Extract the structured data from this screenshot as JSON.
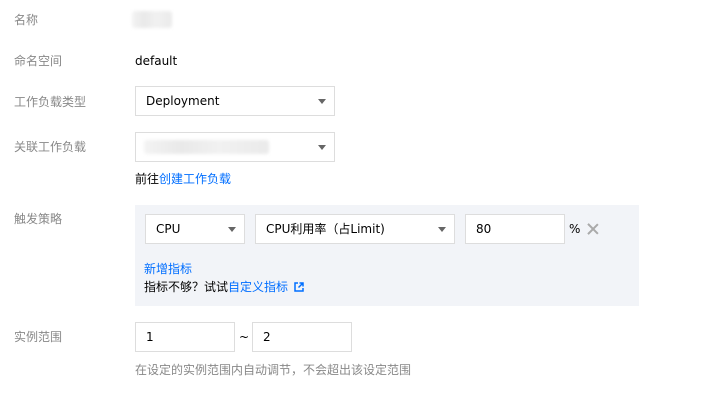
{
  "form": {
    "name": {
      "label": "名称"
    },
    "namespace": {
      "label": "命名空间",
      "value": "default"
    },
    "workload_type": {
      "label": "工作负载类型",
      "value": "Deployment"
    },
    "linked_workload": {
      "label": "关联工作负载",
      "hint_prefix": "前往",
      "hint_link": "创建工作负载"
    },
    "trigger_policy": {
      "label": "触发策略",
      "metric_type": "CPU",
      "metric": "CPU利用率（占Limit)",
      "threshold": "80",
      "unit": "%",
      "add_metric": "新增指标",
      "not_enough_text": "指标不够？试试",
      "custom_metric_link": "自定义指标"
    },
    "instance_range": {
      "label": "实例范围",
      "min": "1",
      "separator": "~",
      "max": "2",
      "hint": "在设定的实例范围内自动调节，不会超出该设定范围"
    }
  },
  "colors": {
    "accent": "#006eff",
    "label": "#888888",
    "panel_bg": "#f2f4f8",
    "border": "#dddddd"
  }
}
